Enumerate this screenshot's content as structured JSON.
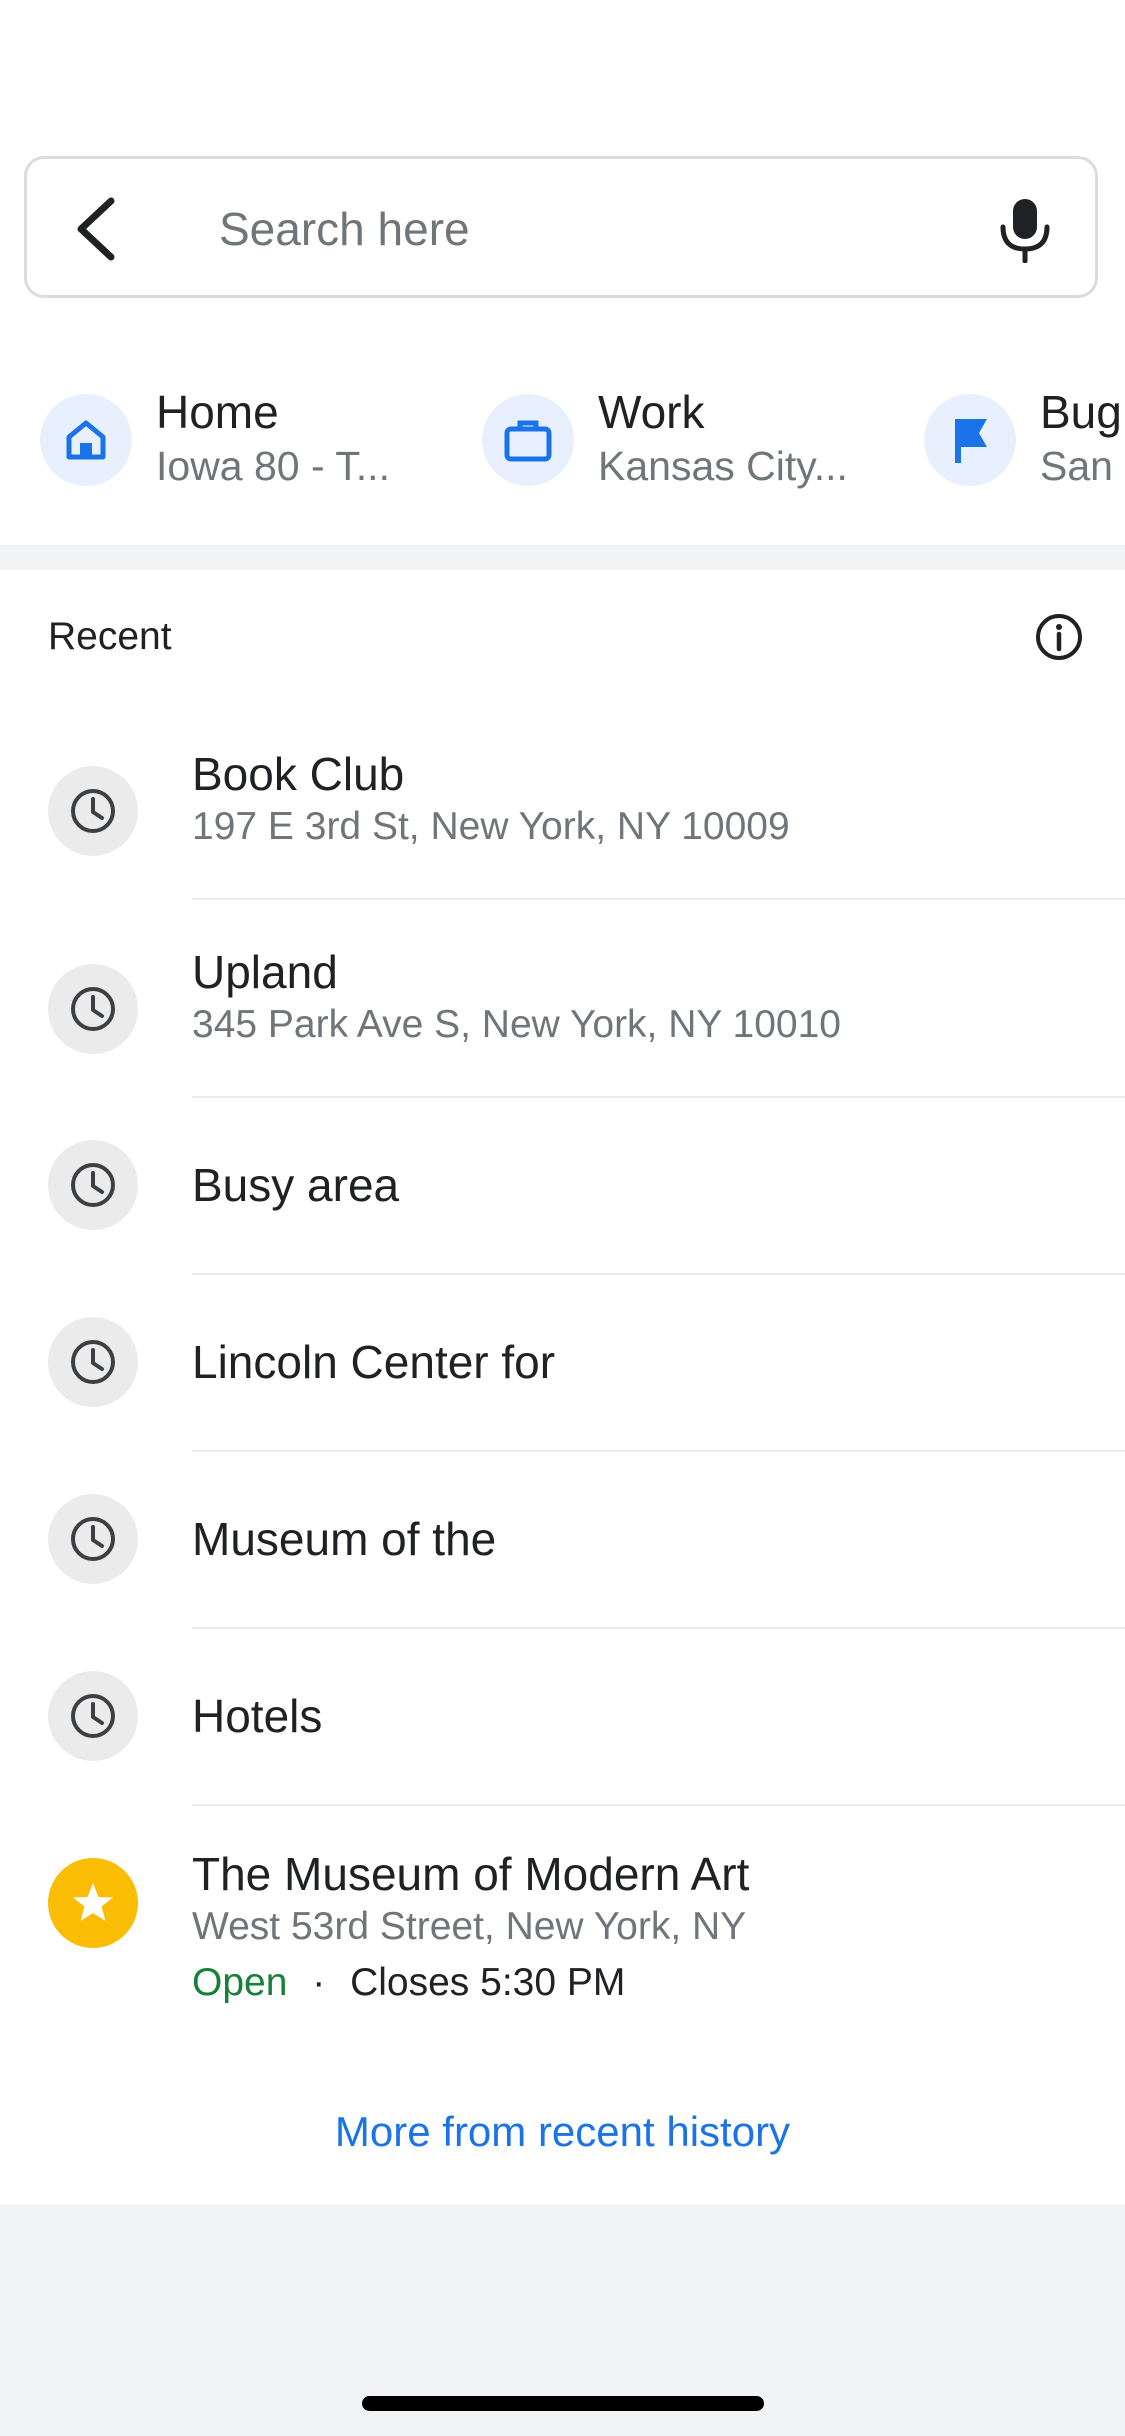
{
  "search": {
    "placeholder": "Search here",
    "back_icon": "chevron-left-icon",
    "mic_icon": "microphone-icon"
  },
  "shortcuts": [
    {
      "title": "Home",
      "subtitle": "Iowa 80 - T...",
      "icon": "home-icon"
    },
    {
      "title": "Work",
      "subtitle": "Kansas City...",
      "icon": "briefcase-icon"
    },
    {
      "title": "Bug",
      "subtitle": "San",
      "icon": "flag-icon"
    }
  ],
  "recent": {
    "header": "Recent",
    "info_icon": "info-icon",
    "items": [
      {
        "title": "Book Club",
        "subtitle": "197 E 3rd St, New York, NY 10009",
        "icon": "clock-icon"
      },
      {
        "title": "Upland",
        "subtitle": "345 Park Ave S, New York, NY 10010",
        "icon": "clock-icon"
      },
      {
        "title": "Busy area",
        "icon": "clock-icon"
      },
      {
        "title": "Lincoln Center for",
        "icon": "clock-icon"
      },
      {
        "title": "Museum of the",
        "icon": "clock-icon"
      },
      {
        "title": "Hotels",
        "icon": "clock-icon"
      },
      {
        "title": "The Museum of Modern Art",
        "subtitle": "West 53rd Street, New York, NY",
        "status": "Open",
        "separator": "·",
        "hours": "Closes 5:30 PM",
        "icon": "star-icon"
      }
    ],
    "more_link": "More from recent history"
  },
  "colors": {
    "accent": "#1a73e8",
    "open_status": "#188038",
    "star_badge": "#fbbc04",
    "shortcut_bg": "#e8f0fe"
  }
}
